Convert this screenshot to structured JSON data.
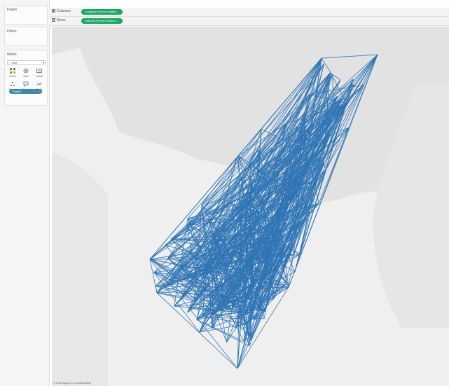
{
  "left_panel": {
    "pages_title": "Pages",
    "filters_title": "Filters",
    "marks": {
      "title": "Marks",
      "type": "Line",
      "buttons": [
        {
          "label": "Color",
          "icon": "color-icon"
        },
        {
          "label": "Size",
          "icon": "size-icon"
        },
        {
          "label": "Label",
          "icon": "label-icon"
        },
        {
          "label": "Detail",
          "icon": "detail-icon"
        },
        {
          "label": "Tooltip",
          "icon": "tooltip-icon"
        },
        {
          "label": "Path",
          "icon": "path-icon"
        }
      ],
      "path_field": "PathID"
    }
  },
  "shelves": {
    "columns_label": "Columns",
    "columns_pill": "Longitude (Proxmi station...",
    "rows_label": "Rows",
    "rows_pill": "Latitude (Proxmi station d..."
  },
  "map": {
    "attribution": "© 2022 Mapbox © OpenStreetMap",
    "line_color": "#2f74b5"
  }
}
